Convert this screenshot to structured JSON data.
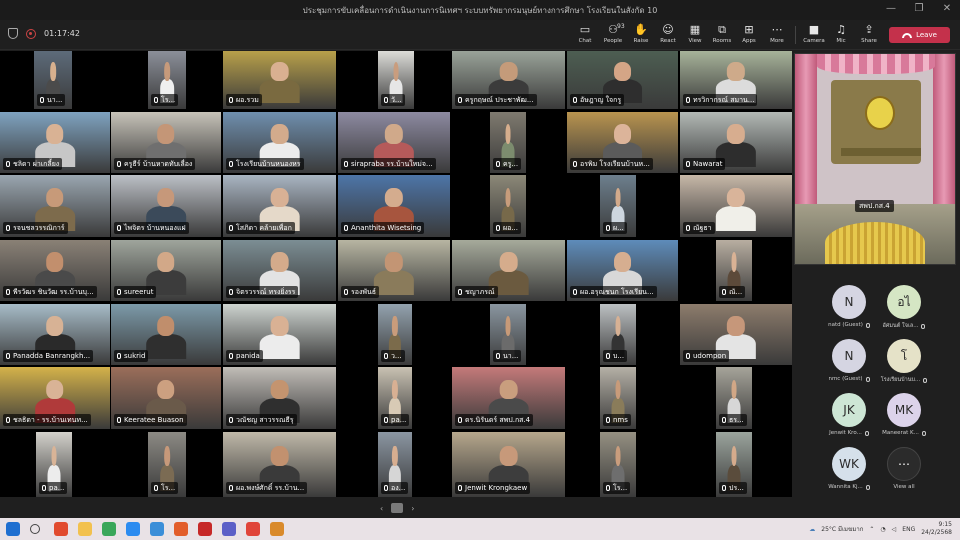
{
  "window": {
    "title": "ประชุมการขับเคลื่อนการดำเนินงานการนิเทศฯ ระบบทรัพยากรมนุษย์ทางการศึกษา โรงเรียนในสังกัด 10",
    "controls": [
      "—",
      "❐",
      "✕"
    ]
  },
  "toolbar": {
    "timer": "01:17:42",
    "buttons": [
      {
        "id": "chat",
        "label": "Chat",
        "icon": "chat-icon",
        "glyph": "▭"
      },
      {
        "id": "people",
        "label": "People",
        "icon": "people-icon",
        "glyph": "⚇",
        "badge": "93"
      },
      {
        "id": "raise",
        "label": "Raise",
        "icon": "hand-icon",
        "glyph": "✋"
      },
      {
        "id": "react",
        "label": "React",
        "icon": "smile-icon",
        "glyph": "☺"
      },
      {
        "id": "view",
        "label": "View",
        "icon": "grid-icon",
        "glyph": "▦"
      },
      {
        "id": "rooms",
        "label": "Rooms",
        "icon": "rooms-icon",
        "glyph": "⧉"
      },
      {
        "id": "apps",
        "label": "Apps",
        "icon": "plus-icon",
        "glyph": "⊞"
      },
      {
        "id": "more",
        "label": "More",
        "icon": "more-icon",
        "glyph": "⋯"
      },
      {
        "id": "camera",
        "label": "Camera",
        "icon": "camera-icon",
        "glyph": "■"
      },
      {
        "id": "mic",
        "label": "Mic",
        "icon": "mic-icon",
        "glyph": "♫"
      },
      {
        "id": "share",
        "label": "Share",
        "icon": "share-icon",
        "glyph": "⇪"
      }
    ],
    "leave_label": "Leave"
  },
  "tiles": [
    {
      "name": "นา...",
      "bg": "#5d6b7a",
      "skin": "#d7b08e",
      "shirt": "#4b4b4b"
    },
    {
      "name": "โร...",
      "bg": "#8b8f99",
      "skin": "#c69a7b",
      "shirt": "#efefef"
    },
    {
      "name": "ผอ.รวม",
      "bg": "#b8a04a",
      "skin": "#d9b091",
      "shirt": "#7a6a40"
    },
    {
      "name": "วั...",
      "bg": "#dcdcd8",
      "skin": "#c99d7e",
      "shirt": "#e6e6e6"
    },
    {
      "name": "ครูกฤษณ์ ประชาพัฒ...",
      "bg": "#9aa399",
      "skin": "#c49b7a",
      "shirt": "#3b3b3b"
    },
    {
      "name": "อัษฎาญ ใจกรู",
      "bg": "#4d5e52",
      "skin": "#d4a586",
      "shirt": "#2e2e2e"
    },
    {
      "name": "ทรวิกากรณ์ สมาน...",
      "bg": "#a7b39a",
      "skin": "#ceaa8a",
      "shirt": "#dcdcdc"
    },
    {
      "name": "ชลิดา ผ่าเกลี้ยง",
      "bg": "#7fa3c0",
      "skin": "#d9b294",
      "shirt": "#c7c7c7"
    },
    {
      "name": "ครูธีร์ บ้านหาดทับเลื่อง",
      "bg": "#c7c3b9",
      "skin": "#c49677",
      "shirt": "#6f6f6f"
    },
    {
      "name": "โรงเรียนบ้านหนองหร",
      "bg": "#6f8fae",
      "skin": "#d3ab8c",
      "shirt": "#ececec"
    },
    {
      "name": "sirapraba รร.บ้านใหม่จ...",
      "bg": "#8d8aa1",
      "skin": "#d0a98a",
      "shirt": "#b55a5a"
    },
    {
      "name": "ครู...",
      "bg": "#7f7a6f",
      "skin": "#d6ae8d",
      "shirt": "#7c8c6e"
    },
    {
      "name": "อรพิม โรงเรียนบ้านห...",
      "bg": "#b9944f",
      "skin": "#dcb49a",
      "shirt": "#5b5b5b"
    },
    {
      "name": "Nawarat",
      "bg": "#b3b9b5",
      "skin": "#d7ad8f",
      "shirt": "#2d2d2d"
    },
    {
      "name": "รจนชลวรรณิการ์",
      "bg": "#9aa6b0",
      "skin": "#c79a79",
      "shirt": "#7d6b4c"
    },
    {
      "name": "ไพจิตร บ้านหนองแฝ",
      "bg": "#bcc0c6",
      "skin": "#c6987a",
      "shirt": "#3b4a5a"
    },
    {
      "name": "โสภิดา คล้ายเพื่อก",
      "bg": "#a9b5c2",
      "skin": "#d8b195",
      "shirt": "#e5d9c9"
    },
    {
      "name": "Ananthita Wisetsing",
      "bg": "#4d75a8",
      "skin": "#d4ac8e",
      "shirt": "#a7553e"
    },
    {
      "name": "ผอ...",
      "bg": "#8c8878",
      "skin": "#c79c7b",
      "shirt": "#77694a"
    },
    {
      "name": "ผ...",
      "bg": "#6d7f8d",
      "skin": "#d2aa8b",
      "shirt": "#cdd6df"
    },
    {
      "name": "ณัฐธา",
      "bg": "#c7b8a8",
      "skin": "#d9b49a",
      "shirt": "#f0efe9"
    },
    {
      "name": "พีรวัฒร ชินวัฒ รร.บ้านบุ...",
      "bg": "#8a8176",
      "skin": "#c28f6d",
      "shirt": "#4a4a4a"
    },
    {
      "name": "sureerut",
      "bg": "#9fa59c",
      "skin": "#d2a888",
      "shirt": "#3c3c3c"
    },
    {
      "name": "จิตรวรรณ์ ทรงยิ่งรร",
      "bg": "#7c8e94",
      "skin": "#d4ab8b",
      "shirt": "#e3e3e3"
    },
    {
      "name": "รองพันธ์",
      "bg": "#b7b5a2",
      "skin": "#c39574",
      "shirt": "#8a7b5b"
    },
    {
      "name": "ชญาภรณ์",
      "bg": "#a6aa9b",
      "skin": "#d5ac8c",
      "shirt": "#6b5a3f"
    },
    {
      "name": "ผอ.อรุณชนก โรงเรียน...",
      "bg": "#5e8cba",
      "skin": "#d6ae90",
      "shirt": "#d8d8d8"
    },
    {
      "name": "ณั...",
      "bg": "#b8aea1",
      "skin": "#d9b295",
      "shirt": "#5c4a3a"
    },
    {
      "name": "Panadda Banrangkh...",
      "bg": "#a7bcc8",
      "skin": "#d7b295",
      "shirt": "#2a2a2a"
    },
    {
      "name": "sukrid",
      "bg": "#7c9aa9",
      "skin": "#c08e6c",
      "shirt": "#2f2f2f"
    },
    {
      "name": "panida",
      "bg": "#cdd3cf",
      "skin": "#d9b194",
      "shirt": "#ececec"
    },
    {
      "name": "ว...",
      "bg": "#93a2ae",
      "skin": "#c99c7b",
      "shirt": "#7b6b4b"
    },
    {
      "name": "นา...",
      "bg": "#8a96a0",
      "skin": "#c79a78",
      "shirt": "#6b6b6b"
    },
    {
      "name": "บ...",
      "bg": "#bcc0c2",
      "skin": "#d7b194",
      "shirt": "#333333"
    },
    {
      "name": "udompon",
      "bg": "#8d7c6c",
      "skin": "#c6977a",
      "shirt": "#e4e4e4"
    },
    {
      "name": "ชลธิดา - รร.บ้านเทนท...",
      "bg": "#d4b24a",
      "skin": "#d9b396",
      "shirt": "#b03a3a"
    },
    {
      "name": "Keeratee Buason",
      "bg": "#9b6e5a",
      "skin": "#cca080",
      "shirt": "#6a5a4a"
    },
    {
      "name": "วณัชญ สาวรรณธีรุ",
      "bg": "#c1bdb7",
      "skin": "#c4946f",
      "shirt": "#2f2f2f"
    },
    {
      "name": "pa...",
      "bg": "#c9c2b3",
      "skin": "#d8b093",
      "shirt": "#d8cab5"
    },
    {
      "name": "ดร.นิรันดร์ สพป.กส.4",
      "bg": "#c47a7a",
      "skin": "#c99e7e",
      "shirt": "#4a4a4a"
    },
    {
      "name": "nms",
      "bg": "#b5b0a6",
      "skin": "#c89b7a",
      "shirt": "#8a7c5a"
    },
    {
      "name": "ธร...",
      "bg": "#a6a49a",
      "skin": "#d1a786",
      "shirt": "#d7d7d7"
    },
    {
      "name": "pa...",
      "bg": "#d3d1cb",
      "skin": "#d9b497",
      "shirt": "#ececec"
    },
    {
      "name": "โร...",
      "bg": "#8c8a84",
      "skin": "#c7997a",
      "shirt": "#7b6b53"
    },
    {
      "name": "ผอ.พงษ์ศักดิ์ รร.บ้าน...",
      "bg": "#c0b9a9",
      "skin": "#c2916f",
      "shirt": "#3a3a3a"
    },
    {
      "name": "อง...",
      "bg": "#8b96a2",
      "skin": "#d7ae90",
      "shirt": "#d6d6d6"
    },
    {
      "name": "Jenwit Krongkaew",
      "bg": "#b6a78c",
      "skin": "#c7997a",
      "shirt": "#3d3d3d"
    },
    {
      "name": "โร...",
      "bg": "#959082",
      "skin": "#c99d7d",
      "shirt": "#6e6e6e"
    },
    {
      "name": "ปร...",
      "bg": "#9ba49d",
      "skin": "#d5ab8c",
      "shirt": "#5a4c3c"
    }
  ],
  "featured": {
    "name": "สพป.กส.4"
  },
  "participants": [
    {
      "initials": "N",
      "name": "natd (Guest)",
      "color": "#d5d5e2"
    },
    {
      "initials": "อไ",
      "name": "อัศมนต์ ใจเล...",
      "color": "#d5e6c4"
    },
    {
      "initials": "N",
      "name": "nmc (Guest)",
      "color": "#d5d5e2"
    },
    {
      "initials": "โ",
      "name": "โรงเรียนบ้านบ...",
      "color": "#e5e2c8"
    },
    {
      "initials": "JK",
      "name": "Jenwit Kro...",
      "color": "#cde6d5"
    },
    {
      "initials": "MK",
      "name": "Maneerat K...",
      "color": "#dcd3ea"
    },
    {
      "initials": "WK",
      "name": "Wannita Kj...",
      "color": "#d5e0ea"
    },
    {
      "initials": "⋯",
      "name": "View all",
      "color": "#2b2b2b"
    }
  ],
  "taskbar": {
    "weather": "25°C มีเมฆมาก",
    "lang": "ENG",
    "time": "9:15",
    "date": "24/2/2568"
  }
}
